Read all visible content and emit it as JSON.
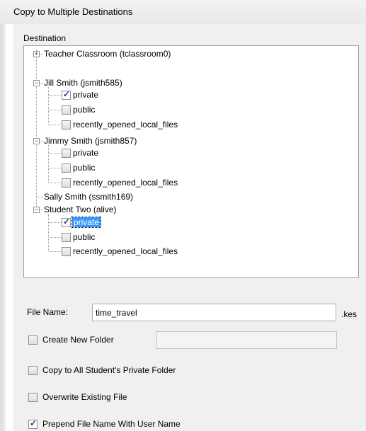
{
  "window": {
    "title": "Copy to Multiple Destinations"
  },
  "destination": {
    "label": "Destination",
    "tree": [
      {
        "label": "Teacher Classroom (tclassroom0)",
        "expander": "+"
      },
      {
        "label": "Jill Smith (jsmith585)",
        "expander": "−",
        "children": [
          {
            "label": "private",
            "checked": true
          },
          {
            "label": "public",
            "checked": false
          },
          {
            "label": "recently_opened_local_files",
            "checked": false
          }
        ]
      },
      {
        "label": "Jimmy Smith (jsmith857)",
        "expander": "−",
        "children": [
          {
            "label": "private",
            "checked": false
          },
          {
            "label": "public",
            "checked": false
          },
          {
            "label": "recently_opened_local_files",
            "checked": false
          }
        ]
      },
      {
        "label": "Sally Smith (ssmith169)"
      },
      {
        "label": "Student Two (alive)",
        "expander": "−",
        "children": [
          {
            "label": "private",
            "checked": true,
            "selected": true
          },
          {
            "label": "public",
            "checked": false
          },
          {
            "label": "recently_opened_local_files",
            "checked": false
          }
        ]
      }
    ]
  },
  "file_name": {
    "label": "File Name:",
    "value": "time_travel",
    "extension": ".kes"
  },
  "options": {
    "create_new_folder": {
      "label": "Create New Folder",
      "checked": false,
      "folder_value": ""
    },
    "copy_to_all_private": {
      "label": "Copy to All Student's Private Folder",
      "checked": false
    },
    "overwrite_existing": {
      "label": "Overwrite Existing File",
      "checked": false
    },
    "prepend_user_name": {
      "label": "Prepend File Name With User Name",
      "checked": true
    }
  }
}
